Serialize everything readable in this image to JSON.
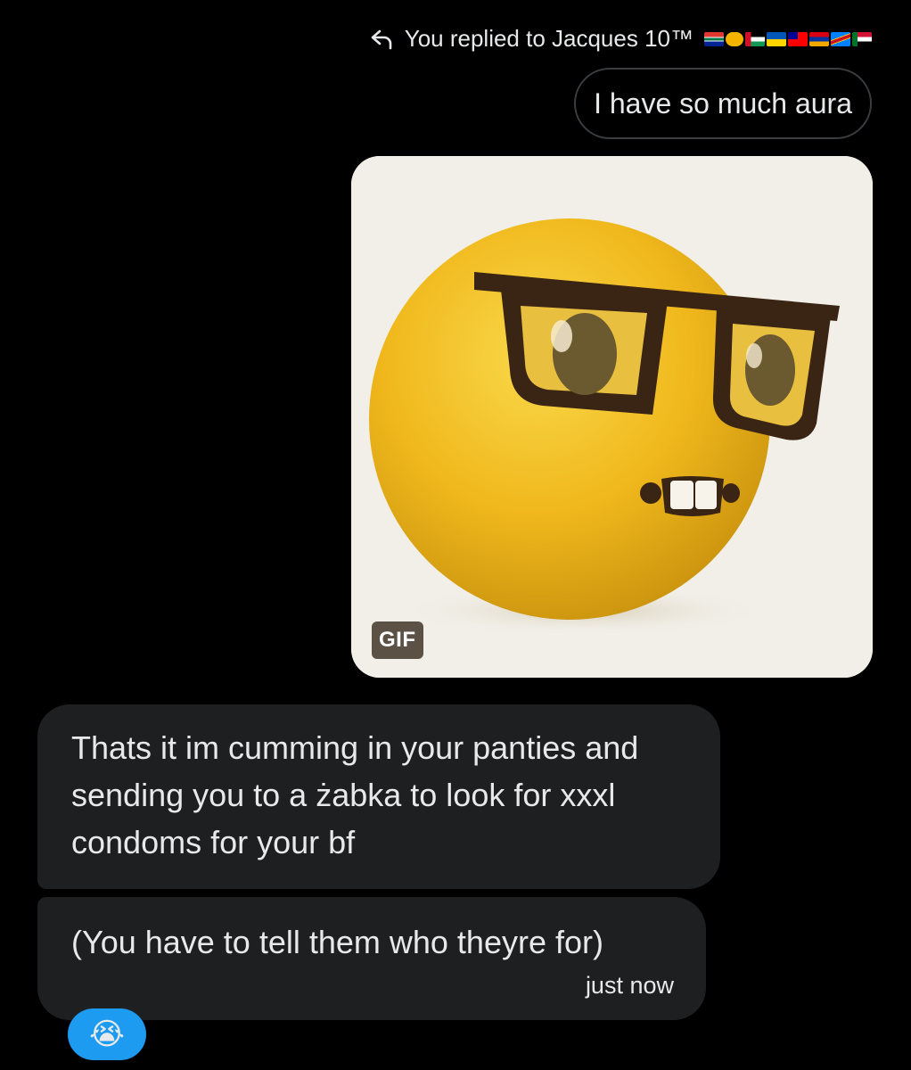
{
  "reply_context": {
    "text": "You replied to Jacques 10™",
    "icon": "reply-arrow-icon",
    "flags": [
      {
        "name": "south-africa-flag-icon",
        "color": "#007a4d"
      },
      {
        "name": "handshake-emoji-icon",
        "color": "#f4b400"
      },
      {
        "name": "palestine-flag-icon",
        "color": "#149954"
      },
      {
        "name": "ukraine-flag-icon",
        "color": "#ffd500"
      },
      {
        "name": "taiwan-flag-icon",
        "color": "#fe0000"
      },
      {
        "name": "armenia-flag-icon",
        "color": "#f2a800"
      },
      {
        "name": "dr-congo-flag-icon",
        "color": "#007fff"
      },
      {
        "name": "sudan-flag-icon",
        "color": "#d21034"
      }
    ]
  },
  "messages": {
    "own_text": "I have so much aura",
    "gif_badge": "GIF",
    "incoming_1": "Thats it im cumming in your panties and sending you to a żabka to look for xxxl condoms for your bf",
    "incoming_2": "(You have to tell them who theyre for)",
    "timestamp": "just now",
    "reaction": "😭"
  },
  "colors": {
    "background": "#000000",
    "incoming_bubble": "#1e1f21",
    "own_bubble_border": "#3a3d40",
    "reaction_bg": "#1d9bf0",
    "text": "#e7e9ea"
  }
}
